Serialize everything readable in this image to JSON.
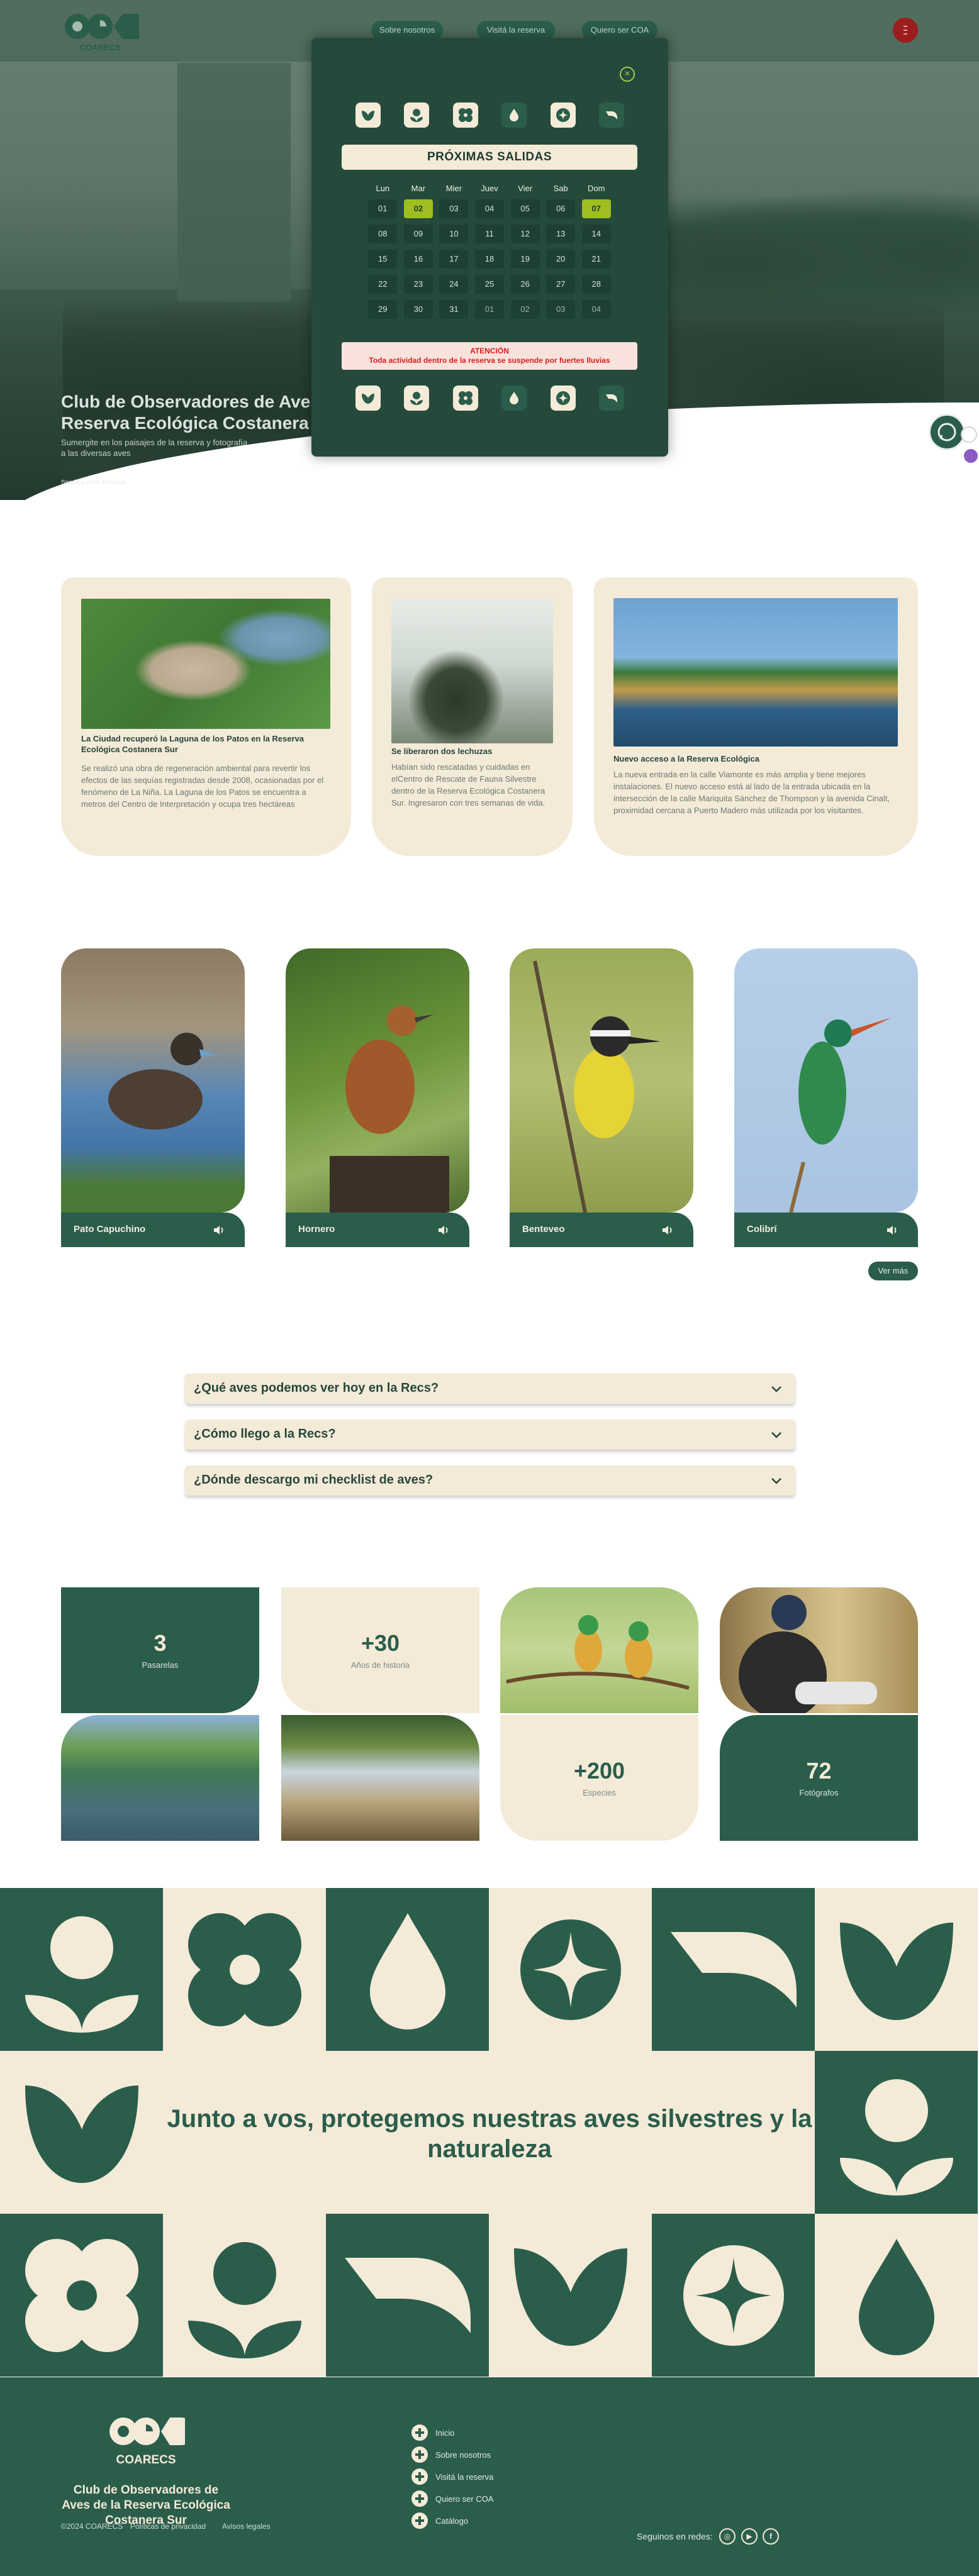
{
  "header": {
    "logo_text": "COARECS",
    "nav": [
      "Sobre nosotros",
      "Visitá la reserva",
      "Quiero ser COA"
    ]
  },
  "hero": {
    "title": "Club de Observadores de Aves de la Reserva Ecológica Costanera Sur",
    "subtitle": "Sumergite en los paisajes de la reserva y fotografía a las diversas aves",
    "credit": "Sendero en la Reserva"
  },
  "modal": {
    "close_icon": "close-icon",
    "title": "PRÓXIMAS SALIDAS",
    "weekdays": [
      "Lun",
      "Mar",
      "Mier",
      "Juev",
      "Vier",
      "Sab",
      "Dom"
    ],
    "weeks": [
      [
        "01",
        "02",
        "03",
        "04",
        "05",
        "06",
        "07"
      ],
      [
        "08",
        "09",
        "10",
        "11",
        "12",
        "13",
        "14"
      ],
      [
        "15",
        "16",
        "17",
        "18",
        "19",
        "20",
        "21"
      ],
      [
        "22",
        "23",
        "24",
        "25",
        "26",
        "27",
        "28"
      ],
      [
        "29",
        "30",
        "31",
        "01",
        "02",
        "03",
        "04"
      ]
    ],
    "selected_days": [
      "02",
      "07"
    ],
    "alert_title": "ATENCIÓN",
    "alert_text": "Toda actividad dentro de la reserva se suspende por fuertes lluvias"
  },
  "news": [
    {
      "title": "La Ciudad recuperó la Laguna de los Patos en la Reserva Ecológica Costanera Sur",
      "text": "Se realizó una obra de regeneración ambiental para revertir los efectos de las sequías registradas desde 2008, ocasionadas por el fenómeno de La Niña. La Laguna de los Patos se encuentra a metros del Centro de Interpretación y ocupa tres hectáreas"
    },
    {
      "title": "Se liberaron dos lechuzas",
      "text": "Habían sido rescatadas y cuidadas en elCentro de Rescate de Fauna Silvestre dentro de la Reserva Ecológica Costanera Sur. Ingresaron con tres semanas de vida."
    },
    {
      "title": "Nuevo acceso a la Reserva Ecológica",
      "text": "La nueva entrada en la calle Viamonte es más amplia y tiene mejores instalaciones. El nuevo acceso está al lado de la entrada ubicada en la intersección de la calle Mariquita Sánchez de Thompson y la avenida Cinalt, proximidad cercana a Puerto Madero más utilizada por los visitantes."
    }
  ],
  "birds": [
    {
      "name": "Pato Capuchino"
    },
    {
      "name": "Hornero"
    },
    {
      "name": "Benteveo"
    },
    {
      "name": "Colibrí"
    }
  ],
  "birds_more": "Ver más",
  "faq": [
    "¿Qué aves podemos ver hoy en la Recs?",
    "¿Cómo llego a la Recs?",
    "¿Dónde descargo mi checklist de aves?"
  ],
  "stats": [
    {
      "value": "3",
      "label": "Pasarelas"
    },
    {
      "value": "+30",
      "label": "Años de historia"
    },
    {
      "value": "+200",
      "label": "Especies"
    },
    {
      "value": "72",
      "label": "Fotógrafos"
    }
  ],
  "tagline": "Junto a vos, protegemos nuestras aves silvestres y la naturaleza",
  "footer": {
    "logo_text": "COARECS",
    "name": "Club de Observadores de Aves de la Reserva Ecológica Costanera Sur",
    "copyright": "©2024 COARECS",
    "privacy": "Políticas de privacidad",
    "legal": "Avisos legales",
    "links": [
      "Inicio",
      "Sobre nosotros",
      "Visitá la reserva",
      "Quiero ser COA",
      "Catálogo"
    ],
    "social_label": "Seguinos en redes:",
    "social_icons": [
      "instagram-icon",
      "youtube-icon",
      "facebook-icon"
    ]
  },
  "colors": {
    "brand_green": "#2b5d4b",
    "cream": "#f4ead8",
    "accent_lime": "#9fbf20",
    "alert_red": "#d32020"
  }
}
